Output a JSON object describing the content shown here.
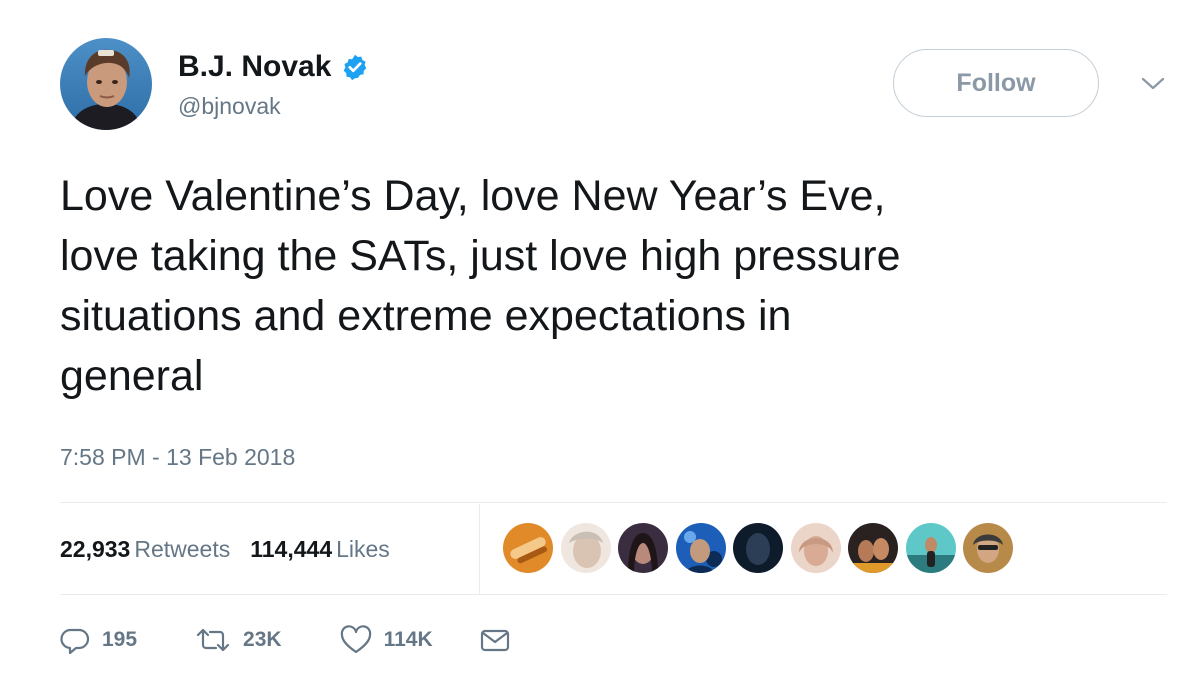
{
  "user": {
    "display_name": "B.J. Novak",
    "handle": "@bjnovak",
    "verified_icon": "verified-badge-icon",
    "accent_color": "#1da1f2"
  },
  "follow_button": {
    "label": "Follow"
  },
  "menu_icon": "chevron-down-icon",
  "tweet": {
    "text": "Love Valentine’s Day, love New Year’s Eve,\nlove taking the SATs, just love high pressure\nsituations and extreme expectations in\ngeneral",
    "timestamp": "7:58 PM - 13 Feb 2018"
  },
  "stats": {
    "retweets_count": "22,933",
    "retweets_label": "Retweets",
    "likes_count": "114,444",
    "likes_label": "Likes"
  },
  "liker_avatars": [
    {
      "icon": "liker-avatar-icon",
      "colors": [
        "#e08a2a",
        "#f5c98a"
      ]
    },
    {
      "icon": "liker-avatar-icon",
      "colors": [
        "#c9bfb4",
        "#efe7df"
      ]
    },
    {
      "icon": "liker-avatar-icon",
      "colors": [
        "#3a2d3f",
        "#7a5a70"
      ]
    },
    {
      "icon": "liker-avatar-icon",
      "colors": [
        "#1d5fb8",
        "#0d2b57"
      ]
    },
    {
      "icon": "liker-avatar-icon",
      "colors": [
        "#0d1b2a",
        "#2b3e55"
      ]
    },
    {
      "icon": "liker-avatar-icon",
      "colors": [
        "#c79a84",
        "#ead5c8"
      ]
    },
    {
      "icon": "liker-avatar-icon",
      "colors": [
        "#2a2220",
        "#e09a2c"
      ]
    },
    {
      "icon": "liker-avatar-icon",
      "colors": [
        "#5ec8c8",
        "#2c7b7f"
      ]
    },
    {
      "icon": "liker-avatar-icon",
      "colors": [
        "#b88a4a",
        "#3b3b3b"
      ]
    }
  ],
  "actions": {
    "reply_count": "195",
    "retweet_count": "23K",
    "like_count": "114K",
    "icons": [
      "reply-icon",
      "retweet-icon",
      "heart-icon",
      "direct-message-icon"
    ]
  }
}
